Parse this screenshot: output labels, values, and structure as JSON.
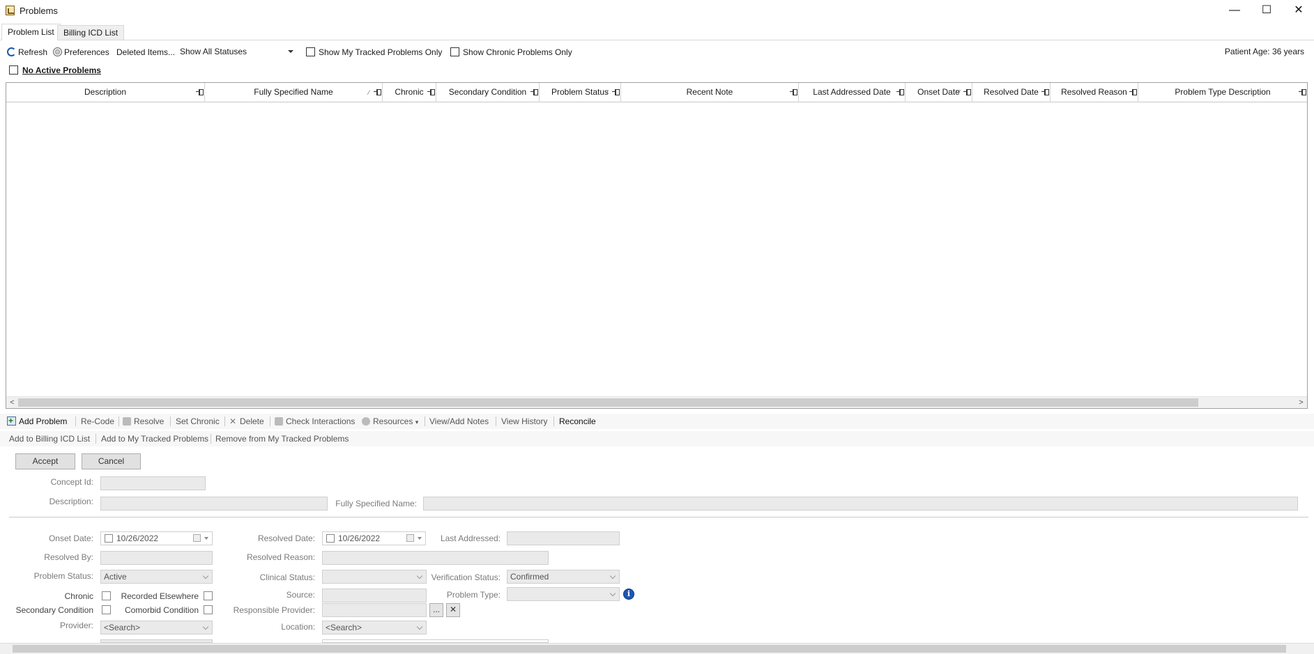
{
  "window": {
    "title": "Problems",
    "minimize": "—",
    "maximize": "☐",
    "close": "✕"
  },
  "tabs": [
    {
      "label": "Problem List",
      "active": true
    },
    {
      "label": "Billing ICD List",
      "active": false
    }
  ],
  "toolbar": {
    "refresh": "Refresh",
    "preferences": "Preferences",
    "deleted_items": "Deleted Items...",
    "status_filter": "Show All Statuses",
    "tracked_only": "Show My Tracked Problems Only",
    "chronic_only": "Show Chronic Problems Only",
    "patient_age": "Patient Age: 36 years"
  },
  "no_active_problems": "No Active Problems",
  "grid": {
    "columns": [
      "Description",
      "Fully Specified Name",
      "Chronic",
      "Secondary Condition",
      "Problem Status",
      "Recent Note",
      "Last Addressed Date",
      "Onset Date",
      "Resolved Date",
      "Resolved Reason",
      "Problem Type Description"
    ],
    "scroll_left": "<",
    "scroll_right": ">"
  },
  "actions": {
    "add_problem": "Add Problem",
    "recode": "Re-Code",
    "resolve": "Resolve",
    "set_chronic": "Set Chronic",
    "delete": "Delete",
    "check_interactions": "Check Interactions",
    "resources": "Resources",
    "resources_caret": "▾",
    "view_add_notes": "View/Add Notes",
    "view_history": "View History",
    "reconcile": "Reconcile",
    "add_billing": "Add to Billing ICD List",
    "add_tracked": "Add to My Tracked Problems",
    "remove_tracked": "Remove from My Tracked Problems"
  },
  "form": {
    "accept": "Accept",
    "cancel": "Cancel",
    "concept_id_label": "Concept Id:",
    "description_label": "Description:",
    "fsn_label": "Fully Specified Name:",
    "onset_date_label": "Onset Date:",
    "onset_date_value": "10/26/2022",
    "resolved_date_label": "Resolved Date:",
    "resolved_date_value": "10/26/2022",
    "last_addressed_label": "Last Addressed:",
    "resolved_by_label": "Resolved By:",
    "resolved_reason_label": "Resolved Reason:",
    "problem_status_label": "Problem Status:",
    "problem_status_value": "Active",
    "clinical_status_label": "Clinical Status:",
    "verification_status_label": "Verification Status:",
    "verification_status_value": "Confirmed",
    "chronic_label": "Chronic",
    "recorded_elsewhere_label": "Recorded Elsewhere",
    "source_label": "Source:",
    "problem_type_label": "Problem Type:",
    "secondary_condition_label": "Secondary Condition",
    "comorbid_condition_label": "Comorbid Condition",
    "responsible_provider_label": "Responsible Provider:",
    "ellipsis_button": "...",
    "clear_button": "✕",
    "provider_label": "Provider:",
    "provider_value": "<Search>",
    "location_label": "Location:",
    "location_value": "<Search>",
    "info": "i"
  }
}
